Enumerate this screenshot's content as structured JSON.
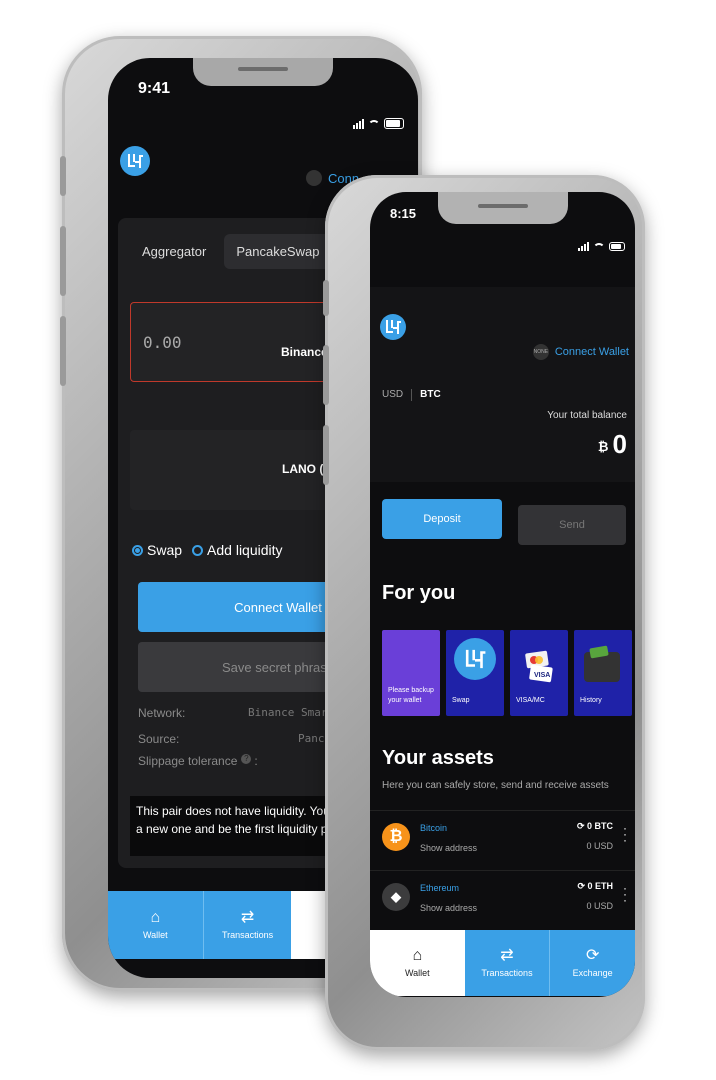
{
  "back": {
    "status_time": "9:41",
    "connect_label": "Conn",
    "tabs": [
      "Aggregator",
      "PancakeSwap"
    ],
    "amount_placeholder": "0.00",
    "from_network": "Binance",
    "to_token": "LANO (B",
    "mode_swap": "Swap",
    "mode_liquidity": "Add liquidity",
    "connect_wallet_button": "Connect Wallet",
    "save_phrase_button": "Save secret phrase",
    "network_label": "Network:",
    "network_value": "Binance Smart",
    "source_label": "Source:",
    "source_value": "Pancak",
    "slippage_label": "Slippage tolerance",
    "slippage_suffix": ":",
    "warning_text": "This pair does not have liquidity. You can c\na new one and be the first liquidity provide",
    "nav": [
      {
        "icon": "home",
        "label": "Wallet"
      },
      {
        "icon": "swap-arrows",
        "label": "Transactions"
      },
      {
        "icon": "exchange",
        "label": "Ex"
      }
    ]
  },
  "front": {
    "status_time": "8:15",
    "avatar_text": "NONE",
    "connect_wallet": "Connect Wallet",
    "currency_options": [
      "USD",
      "BTC"
    ],
    "selected_currency": "BTC",
    "total_balance_label": "Your total balance",
    "balance_symbol": "₿",
    "balance_value": "0",
    "deposit_button": "Deposit",
    "send_button": "Send",
    "for_you_title": "For you",
    "cards": [
      {
        "label": "Please backup your wallet",
        "icon": "none"
      },
      {
        "label": "Swap",
        "icon": "logo"
      },
      {
        "label": "VISA/MC",
        "icon": "credit-card"
      },
      {
        "label": "History",
        "icon": "wallet"
      }
    ],
    "assets_title": "Your assets",
    "assets_subtitle": "Here you can safely store, send and receive assets",
    "assets": [
      {
        "name": "Bitcoin",
        "address_label": "Show address",
        "amount": "0 BTC",
        "usd": "0 USD",
        "color": "#f7931a",
        "symbol": "₿"
      },
      {
        "name": "Ethereum",
        "address_label": "Show address",
        "amount": "0 ETH",
        "usd": "0 USD",
        "color": "#3c3c3d",
        "symbol": "◆"
      }
    ],
    "nav": [
      {
        "icon": "home",
        "label": "Wallet"
      },
      {
        "icon": "swap-arrows",
        "label": "Transactions"
      },
      {
        "icon": "exchange",
        "label": "Exchange"
      }
    ]
  },
  "colors": {
    "accent": "#3aa0e6",
    "screen_bg": "#0d0d0f",
    "purple_card": "#6a3fd8",
    "blue_card": "#1f22a8",
    "error_border": "#c0392b"
  }
}
